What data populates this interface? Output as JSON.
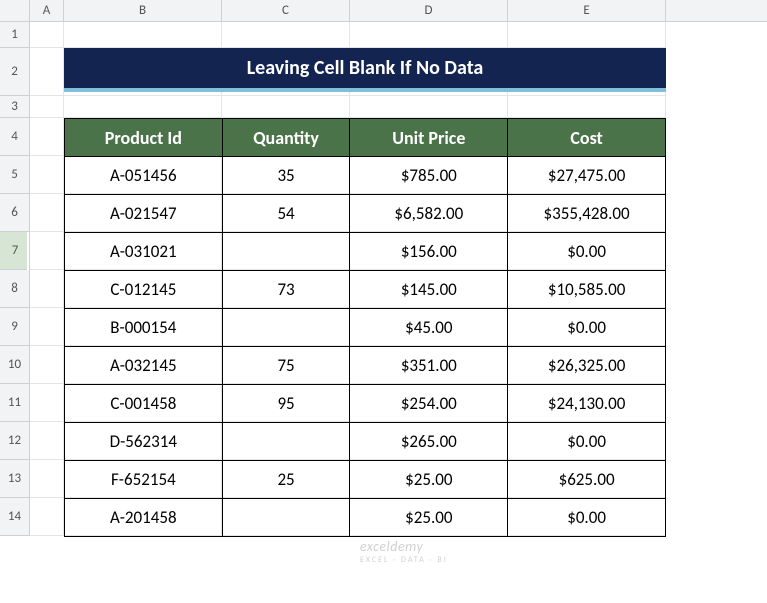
{
  "columns": [
    "A",
    "B",
    "C",
    "D",
    "E"
  ],
  "rows": [
    "1",
    "2",
    "3",
    "4",
    "5",
    "6",
    "7",
    "8",
    "9",
    "10",
    "11",
    "12",
    "13",
    "14"
  ],
  "selected_row": "7",
  "title": "Leaving Cell Blank If No Data",
  "table": {
    "headers": [
      "Product Id",
      "Quantity",
      "Unit Price",
      "Cost"
    ],
    "data": [
      {
        "id": "A-051456",
        "qty": "35",
        "price": "$785.00",
        "cost": "$27,475.00"
      },
      {
        "id": "A-021547",
        "qty": "54",
        "price": "$6,582.00",
        "cost": "$355,428.00"
      },
      {
        "id": "A-031021",
        "qty": "",
        "price": "$156.00",
        "cost": "$0.00"
      },
      {
        "id": "C-012145",
        "qty": "73",
        "price": "$145.00",
        "cost": "$10,585.00"
      },
      {
        "id": "B-000154",
        "qty": "",
        "price": "$45.00",
        "cost": "$0.00"
      },
      {
        "id": "A-032145",
        "qty": "75",
        "price": "$351.00",
        "cost": "$26,325.00"
      },
      {
        "id": "C-001458",
        "qty": "95",
        "price": "$254.00",
        "cost": "$24,130.00"
      },
      {
        "id": "D-562314",
        "qty": "",
        "price": "$265.00",
        "cost": "$0.00"
      },
      {
        "id": "F-652154",
        "qty": "25",
        "price": "$25.00",
        "cost": "$625.00"
      },
      {
        "id": "A-201458",
        "qty": "",
        "price": "$25.00",
        "cost": "$0.00"
      }
    ]
  },
  "watermark": {
    "text": "exceldemy",
    "sub": "EXCEL · DATA · BI"
  },
  "chart_data": {
    "type": "table",
    "title": "Leaving Cell Blank If No Data",
    "headers": [
      "Product Id",
      "Quantity",
      "Unit Price",
      "Cost"
    ],
    "rows": [
      [
        "A-051456",
        35,
        785.0,
        27475.0
      ],
      [
        "A-021547",
        54,
        6582.0,
        355428.0
      ],
      [
        "A-031021",
        null,
        156.0,
        0.0
      ],
      [
        "C-012145",
        73,
        145.0,
        10585.0
      ],
      [
        "B-000154",
        null,
        45.0,
        0.0
      ],
      [
        "A-032145",
        75,
        351.0,
        26325.0
      ],
      [
        "C-001458",
        95,
        254.0,
        24130.0
      ],
      [
        "D-562314",
        null,
        265.0,
        0.0
      ],
      [
        "F-652154",
        25,
        25.0,
        625.0
      ],
      [
        "A-201458",
        null,
        25.0,
        0.0
      ]
    ]
  }
}
